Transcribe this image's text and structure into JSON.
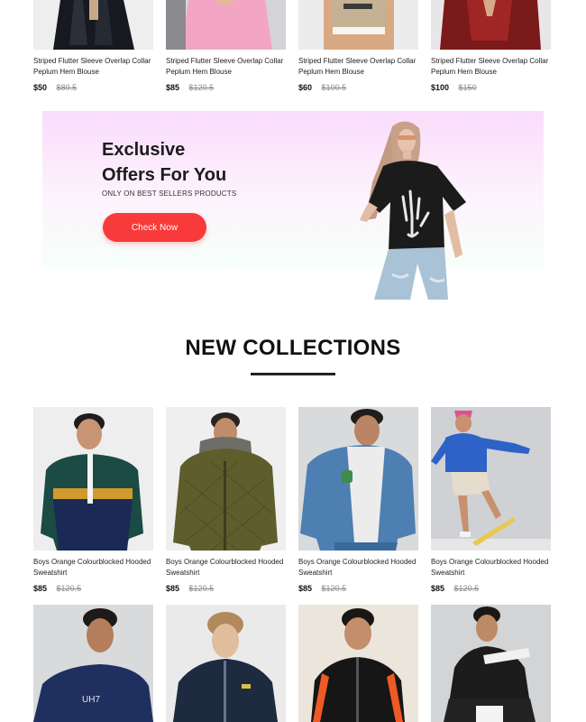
{
  "top_products": [
    {
      "name": "Striped Flutter Sleeve Overlap Collar Peplum Hem Blouse",
      "price": "$50",
      "old_price": "$80.5"
    },
    {
      "name": "Striped Flutter Sleeve Overlap Collar Peplum Hem Blouse",
      "price": "$85",
      "old_price": "$120.5"
    },
    {
      "name": "Striped Flutter Sleeve Overlap Collar Peplum Hem Blouse",
      "price": "$60",
      "old_price": "$100.5"
    },
    {
      "name": "Striped Flutter Sleeve Overlap Collar Peplum Hem Blouse",
      "price": "$100",
      "old_price": "$150"
    }
  ],
  "banner": {
    "title_line1": "Exclusive",
    "title_line2": "Offers For You",
    "subtitle": "ONLY ON BEST SELLERS PRODUCTS",
    "cta_label": "Check Now"
  },
  "new_collections": {
    "title": "NEW COLLECTIONS",
    "products": [
      {
        "name": "Boys Orange Colourblocked Hooded Sweatshirt",
        "price": "$85",
        "old_price": "$120.5"
      },
      {
        "name": "Boys Orange Colourblocked Hooded Sweatshirt",
        "price": "$85",
        "old_price": "$120.5"
      },
      {
        "name": "Boys Orange Colourblocked Hooded Sweatshirt",
        "price": "$85",
        "old_price": "$120.5"
      },
      {
        "name": "Boys Orange Colourblocked Hooded Sweatshirt",
        "price": "$85",
        "old_price": "$120.5"
      }
    ]
  },
  "colors": {
    "accent": "#f93a3a",
    "banner_top": "#f9dcfb",
    "banner_bottom": "#f6fff9",
    "text": "#171717",
    "muted": "#8a8a8a"
  }
}
